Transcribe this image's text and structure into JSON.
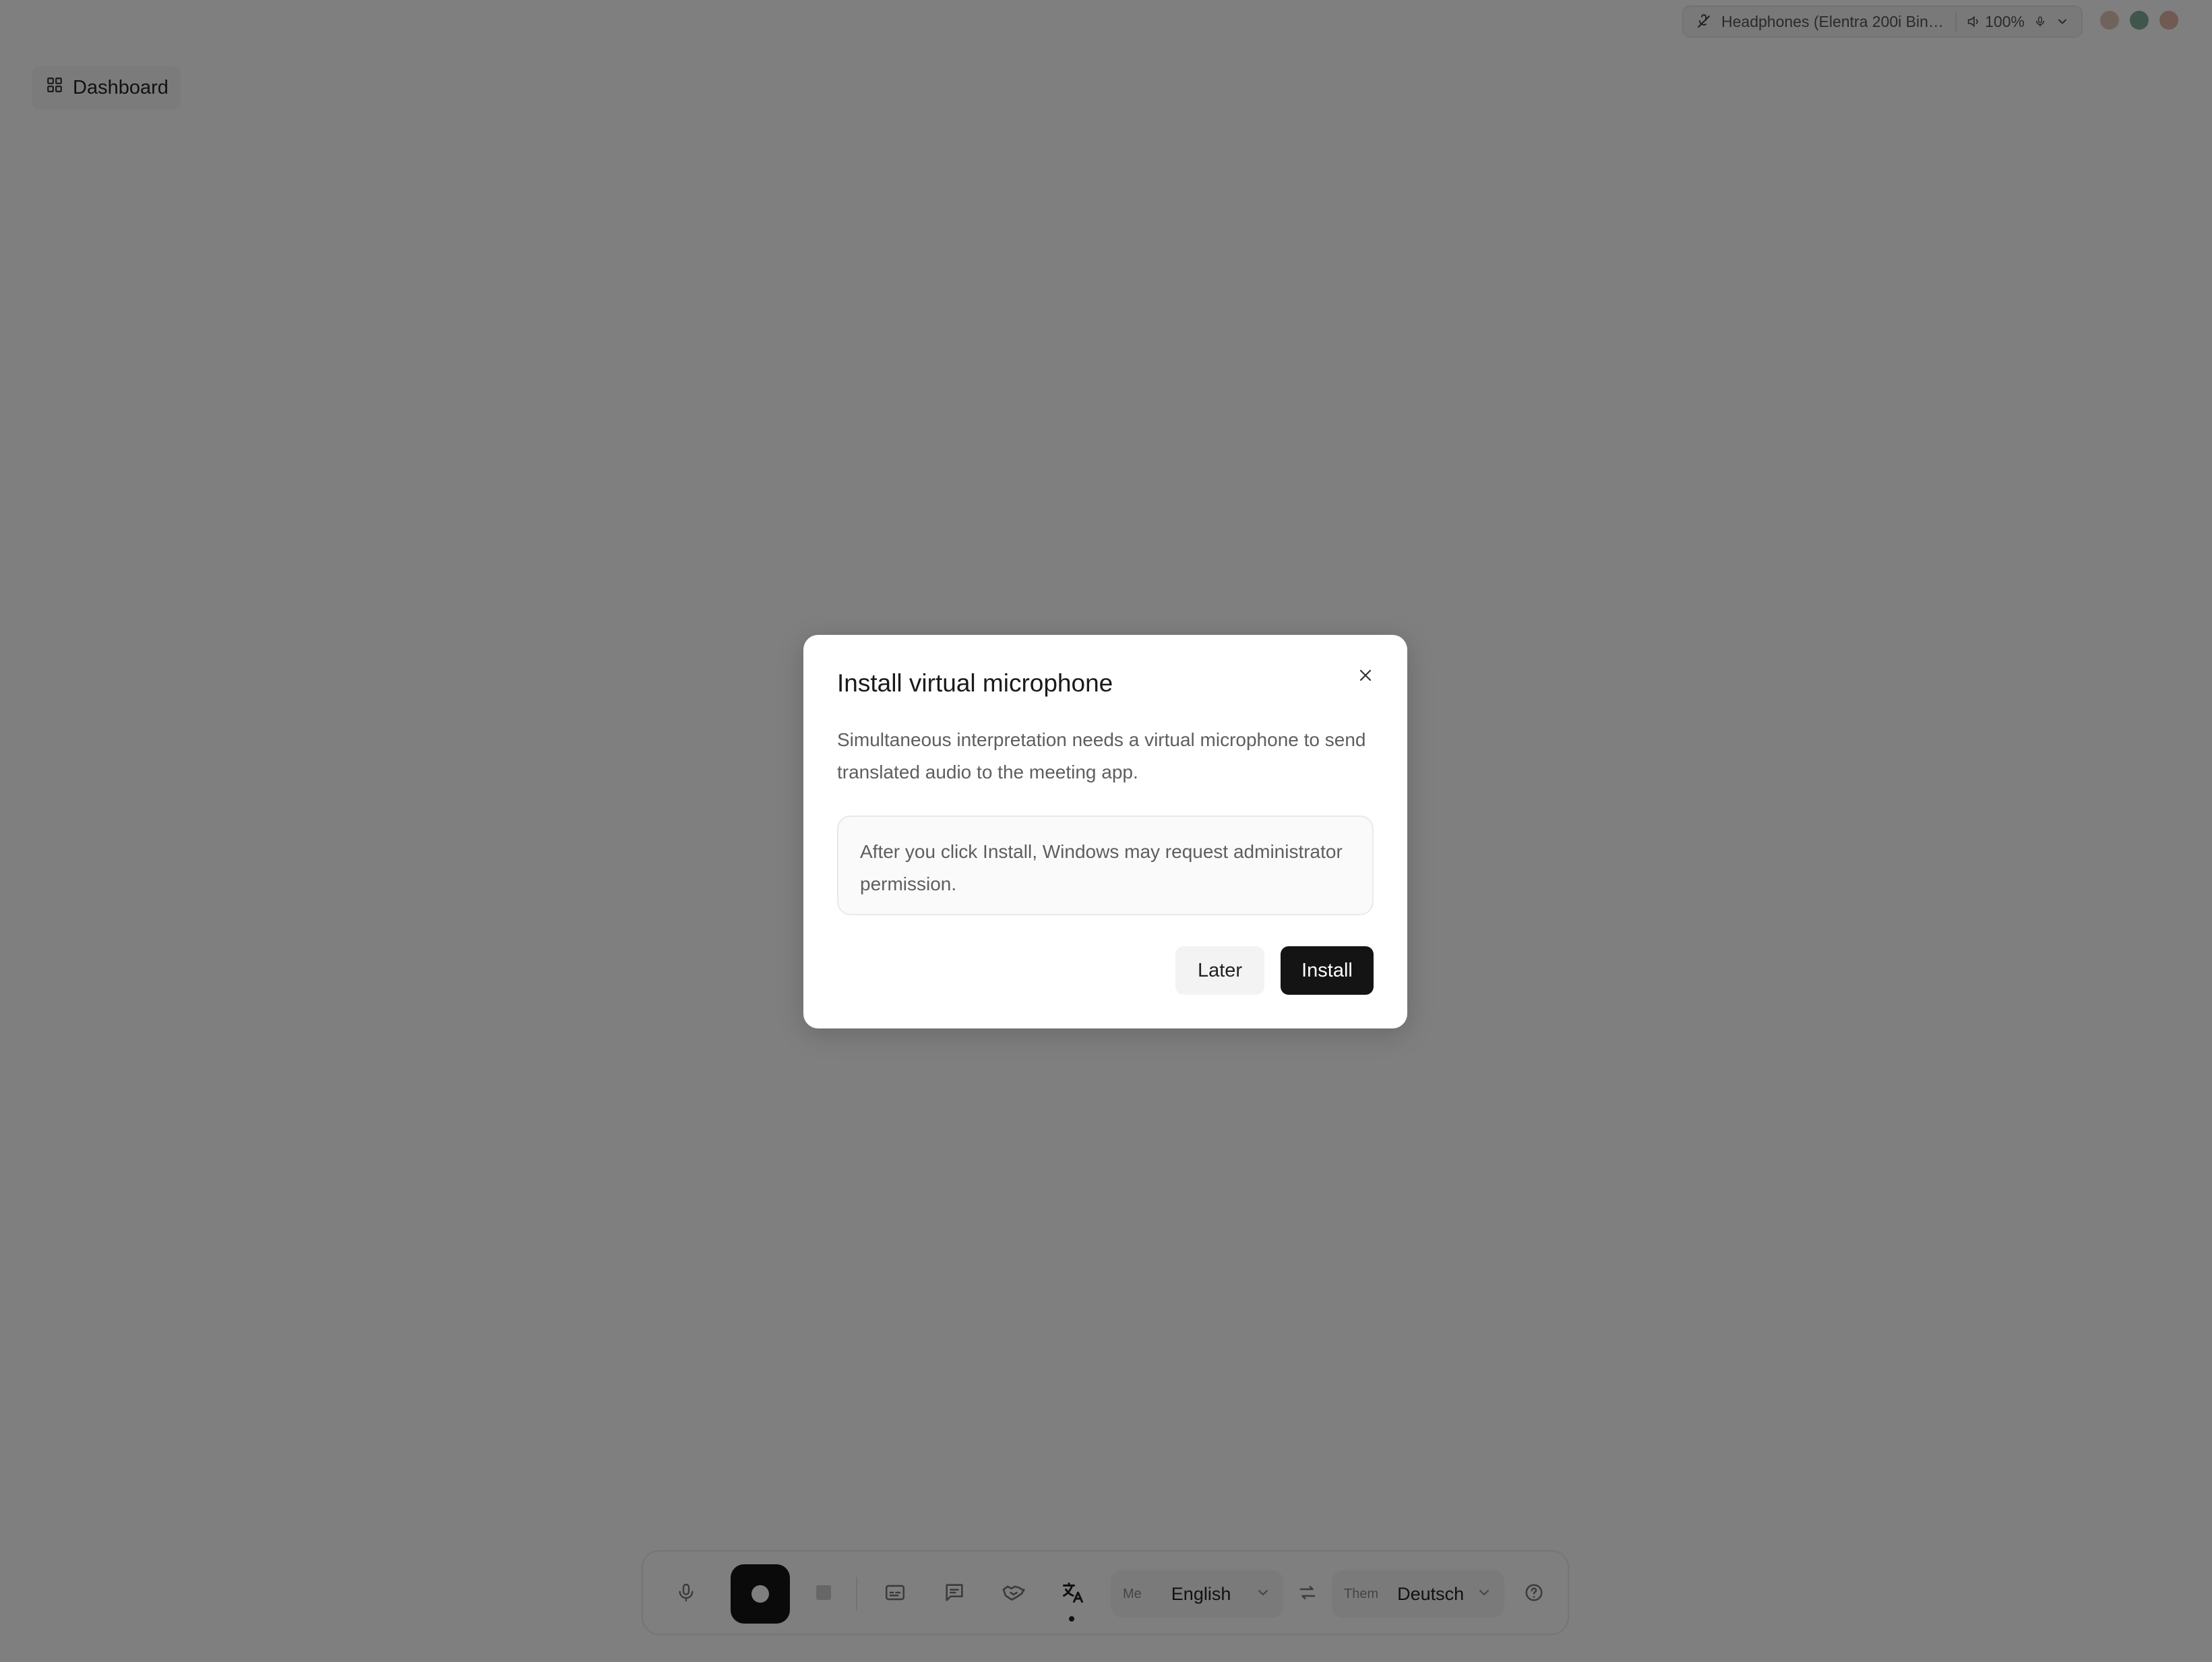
{
  "topbar": {
    "device_name": "Headphones (Elentra 200i Bina...",
    "volume": "100%",
    "icons": [
      "mic-off-icon",
      "speaker-icon",
      "mic-icon",
      "chevron-down-icon"
    ]
  },
  "window_controls": [
    "window-control-1",
    "window-control-2",
    "window-control-3"
  ],
  "dashboard": {
    "label": "Dashboard",
    "icon": "grid-icon"
  },
  "toolbar": {
    "icons": [
      "mic-icon",
      "record-icon",
      "stop-icon",
      "captions-icon",
      "chat-icon",
      "handshake-icon",
      "translate-icon",
      "swap-icon",
      "help-icon"
    ],
    "me_label": "Me",
    "me_language": "English",
    "them_label": "Them",
    "them_language": "Deutsch"
  },
  "modal": {
    "title": "Install virtual microphone",
    "description": "Simultaneous interpretation needs a virtual microphone to send translated audio to the meeting app.",
    "note": "After you click Install, Windows may request administrator permission.",
    "later_label": "Later",
    "install_label": "Install"
  },
  "colors": {
    "overlay": "#000000",
    "primary_button": "#141414",
    "secondary_button": "#f3f3f3"
  }
}
